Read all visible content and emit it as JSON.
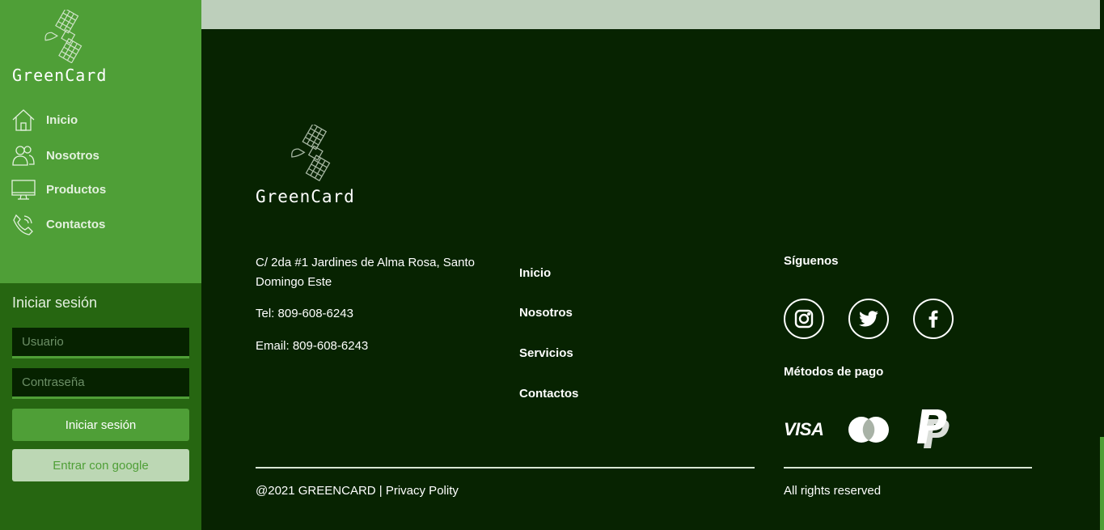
{
  "brand": {
    "name": "GreenCard"
  },
  "sidebar": {
    "nav": [
      {
        "label": "Inicio",
        "icon": "home-icon"
      },
      {
        "label": "Nosotros",
        "icon": "users-icon"
      },
      {
        "label": "Productos",
        "icon": "monitor-icon"
      },
      {
        "label": "Contactos",
        "icon": "phone-icon"
      }
    ]
  },
  "login": {
    "title": "Iniciar sesión",
    "username_placeholder": "Usuario",
    "password_placeholder": "Contraseña",
    "submit_label": "Iniciar sesión",
    "google_label": "Entrar con google"
  },
  "footer": {
    "address": "C/ 2da #1 Jardines de Alma Rosa, Santo Domingo Este",
    "phone": "Tel: 809-608-6243",
    "email": "Email: 809-608-6243",
    "links": [
      "Inicio",
      "Nosotros",
      "Servicios",
      "Contactos"
    ],
    "follow_heading": "Síguenos",
    "social": [
      "instagram-icon",
      "twitter-icon",
      "facebook-icon"
    ],
    "payment_heading": "Métodos de pago",
    "payments": {
      "visa": "VISA",
      "mastercard": "mastercard-icon",
      "paypal": "paypal-icon"
    },
    "copyright_prefix": "@2021 GREENCARD | ",
    "privacy": "Privacy Polity",
    "rights": "All rights reserved"
  },
  "colors": {
    "sidebar": "#4f9f37",
    "login_panel": "#266611",
    "footer_bg": "#072301",
    "topbar": "#bdcfbb"
  }
}
